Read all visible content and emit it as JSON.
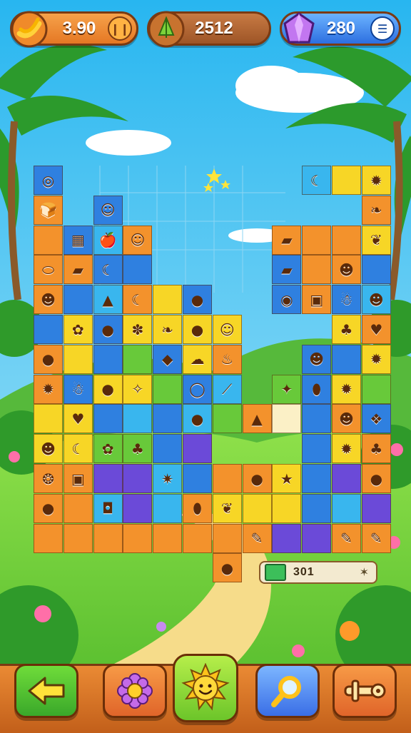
{
  "hud": {
    "coins": {
      "value": "3.90",
      "icon": "banana-bunch-icon",
      "button_icon": "pause-bars-icon"
    },
    "gems": {
      "value": "2512",
      "icon": "green-leaf-gem-icon"
    },
    "crystals": {
      "value": "280",
      "icon": "purple-crystal-icon",
      "button_icon": "menu-bars-icon"
    }
  },
  "progress_panel": {
    "value": "301",
    "icon": "green-gem-icon",
    "end_icon": "sparkle-icon"
  },
  "toolbar": [
    {
      "name": "back-button",
      "icon": "left-arrow-icon",
      "color": "#45b82c"
    },
    {
      "name": "settings-button",
      "icon": "flower-gear-icon",
      "color": "#e86a2b"
    },
    {
      "name": "sun-hint-button",
      "icon": "smiling-sun-icon",
      "color": "#8dcf2c"
    },
    {
      "name": "search-button",
      "icon": "magnifier-icon",
      "color": "#3a6ee6"
    },
    {
      "name": "tools-button",
      "icon": "wrench-icon",
      "color": "#e86a2b"
    }
  ],
  "colors": {
    "sky": "#5ac8f2",
    "grass": "#6dcf3c",
    "orange": "#f3922c",
    "yellow": "#f7d626",
    "blue": "#2f80e0",
    "green": "#68c93a",
    "purple": "#6b4ad8",
    "cyan": "#39b6ee",
    "cream": "#fbf0c6",
    "border": "#7a3a12"
  },
  "board": {
    "tiles": [
      {
        "r": 0,
        "c": 0,
        "color": "blue",
        "icon": "blue-swirl-icon",
        "glyph": "◎"
      },
      {
        "r": 1,
        "c": 0,
        "color": "orange",
        "icon": "bread-icon",
        "glyph": "🍞"
      },
      {
        "r": 1,
        "c": 2,
        "color": "blue",
        "icon": "smiling-block-icon",
        "glyph": "☺"
      },
      {
        "r": 2,
        "c": 0,
        "color": "orange",
        "icon": "",
        "glyph": ""
      },
      {
        "r": 2,
        "c": 1,
        "color": "blue",
        "icon": "green-box-icon",
        "glyph": "▦"
      },
      {
        "r": 2,
        "c": 2,
        "color": "cyan",
        "icon": "red-apple-icon",
        "glyph": "🍎"
      },
      {
        "r": 2,
        "c": 3,
        "color": "orange",
        "icon": "yellow-smile-icon",
        "glyph": "☺"
      },
      {
        "r": 3,
        "c": 0,
        "color": "orange",
        "icon": "white-egg-icon",
        "glyph": "⬭"
      },
      {
        "r": 3,
        "c": 1,
        "color": "orange",
        "icon": "orange-log-icon",
        "glyph": "▰"
      },
      {
        "r": 3,
        "c": 2,
        "color": "blue",
        "icon": "yellow-banana-icon",
        "glyph": "☾"
      },
      {
        "r": 3,
        "c": 3,
        "color": "blue",
        "icon": "",
        "glyph": ""
      },
      {
        "r": 4,
        "c": 0,
        "color": "orange",
        "icon": "brown-creature-icon",
        "glyph": "☻"
      },
      {
        "r": 4,
        "c": 1,
        "color": "blue",
        "icon": "",
        "glyph": ""
      },
      {
        "r": 4,
        "c": 2,
        "color": "cyan",
        "icon": "orange-carrot-icon",
        "glyph": "▲"
      },
      {
        "r": 4,
        "c": 3,
        "color": "orange",
        "icon": "yellow-banana-icon",
        "glyph": "☾"
      },
      {
        "r": 4,
        "c": 4,
        "color": "yellow",
        "icon": "",
        "glyph": ""
      },
      {
        "r": 4,
        "c": 5,
        "color": "blue",
        "icon": "purple-blob-icon",
        "glyph": "●"
      },
      {
        "r": 5,
        "c": 0,
        "color": "blue",
        "icon": "",
        "glyph": ""
      },
      {
        "r": 5,
        "c": 1,
        "color": "yellow",
        "icon": "green-frog-icon",
        "glyph": "✿"
      },
      {
        "r": 5,
        "c": 2,
        "color": "blue",
        "icon": "green-apple-icon",
        "glyph": "●"
      },
      {
        "r": 5,
        "c": 3,
        "color": "yellow",
        "icon": "green-bush-icon",
        "glyph": "✽"
      },
      {
        "r": 5,
        "c": 4,
        "color": "yellow",
        "icon": "purple-leaf-icon",
        "glyph": "❧"
      },
      {
        "r": 5,
        "c": 5,
        "color": "yellow",
        "icon": "orange-ball-icon",
        "glyph": "●"
      },
      {
        "r": 5,
        "c": 6,
        "color": "yellow",
        "icon": "yellow-face-icon",
        "glyph": "☺"
      },
      {
        "r": 6,
        "c": 0,
        "color": "orange",
        "icon": "orange-fruit-icon",
        "glyph": "●"
      },
      {
        "r": 6,
        "c": 1,
        "color": "yellow",
        "icon": "",
        "glyph": ""
      },
      {
        "r": 6,
        "c": 2,
        "color": "blue",
        "icon": "",
        "glyph": ""
      },
      {
        "r": 6,
        "c": 3,
        "color": "green",
        "icon": "",
        "glyph": ""
      },
      {
        "r": 6,
        "c": 4,
        "color": "blue",
        "icon": "purple-rock-icon",
        "glyph": "◆"
      },
      {
        "r": 6,
        "c": 5,
        "color": "yellow",
        "icon": "white-sheep-icon",
        "glyph": "☁"
      },
      {
        "r": 6,
        "c": 6,
        "color": "orange",
        "icon": "orange-sack-icon",
        "glyph": "♨"
      },
      {
        "r": 7,
        "c": 0,
        "color": "orange",
        "icon": "yellow-flower-icon",
        "glyph": "✹"
      },
      {
        "r": 7,
        "c": 1,
        "color": "blue",
        "icon": "white-ghost-icon",
        "glyph": "☃"
      },
      {
        "r": 7,
        "c": 2,
        "color": "yellow",
        "icon": "dark-plum-icon",
        "glyph": "●"
      },
      {
        "r": 7,
        "c": 3,
        "color": "yellow",
        "icon": "white-bird-icon",
        "glyph": "✧"
      },
      {
        "r": 7,
        "c": 4,
        "color": "green",
        "icon": "",
        "glyph": ""
      },
      {
        "r": 7,
        "c": 5,
        "color": "blue",
        "icon": "orange-ring-icon",
        "glyph": "◯"
      },
      {
        "r": 7,
        "c": 6,
        "color": "cyan",
        "icon": "white-feather-icon",
        "glyph": "⟋"
      },
      {
        "r": 8,
        "c": 0,
        "color": "yellow",
        "icon": "",
        "glyph": ""
      },
      {
        "r": 8,
        "c": 1,
        "color": "yellow",
        "icon": "red-chili-icon",
        "glyph": "♥"
      },
      {
        "r": 8,
        "c": 2,
        "color": "blue",
        "icon": "",
        "glyph": ""
      },
      {
        "r": 8,
        "c": 3,
        "color": "cyan",
        "icon": "",
        "glyph": ""
      },
      {
        "r": 8,
        "c": 4,
        "color": "blue",
        "icon": "",
        "glyph": ""
      },
      {
        "r": 8,
        "c": 5,
        "color": "cyan",
        "icon": "orange-seed-icon",
        "glyph": "●"
      },
      {
        "r": 8,
        "c": 6,
        "color": "green",
        "icon": "",
        "glyph": ""
      },
      {
        "r": 9,
        "c": 0,
        "color": "yellow",
        "icon": "grey-squirrel-icon",
        "glyph": "☻"
      },
      {
        "r": 9,
        "c": 1,
        "color": "yellow",
        "icon": "yellow-pear-icon",
        "glyph": "☾"
      },
      {
        "r": 9,
        "c": 2,
        "color": "green",
        "icon": "green-turtle-icon",
        "glyph": "✿"
      },
      {
        "r": 9,
        "c": 3,
        "color": "green",
        "icon": "green-pot-icon",
        "glyph": "♣"
      },
      {
        "r": 9,
        "c": 4,
        "color": "blue",
        "icon": "",
        "glyph": ""
      },
      {
        "r": 9,
        "c": 5,
        "color": "purple",
        "icon": "",
        "glyph": ""
      },
      {
        "r": 10,
        "c": 0,
        "color": "orange",
        "icon": "red-donut-icon",
        "glyph": "❂"
      },
      {
        "r": 10,
        "c": 1,
        "color": "orange",
        "icon": "orange-box-icon",
        "glyph": "▣"
      },
      {
        "r": 10,
        "c": 2,
        "color": "purple",
        "icon": "",
        "glyph": ""
      },
      {
        "r": 10,
        "c": 3,
        "color": "purple",
        "icon": "",
        "glyph": ""
      },
      {
        "r": 10,
        "c": 4,
        "color": "cyan",
        "icon": "orange-star-blob-icon",
        "glyph": "✷"
      },
      {
        "r": 10,
        "c": 5,
        "color": "blue",
        "icon": "",
        "glyph": ""
      },
      {
        "r": 10,
        "c": 6,
        "color": "orange",
        "icon": "",
        "glyph": ""
      },
      {
        "r": 11,
        "c": 0,
        "color": "orange",
        "icon": "orange-pumpkin-icon",
        "glyph": "●"
      },
      {
        "r": 11,
        "c": 1,
        "color": "orange",
        "icon": "",
        "glyph": ""
      },
      {
        "r": 11,
        "c": 2,
        "color": "cyan",
        "icon": "blue-robot-icon",
        "glyph": "◘"
      },
      {
        "r": 11,
        "c": 3,
        "color": "purple",
        "icon": "",
        "glyph": ""
      },
      {
        "r": 11,
        "c": 4,
        "color": "cyan",
        "icon": "",
        "glyph": ""
      },
      {
        "r": 11,
        "c": 5,
        "color": "orange",
        "icon": "orange-bean-icon",
        "glyph": "⬮"
      },
      {
        "r": 11,
        "c": 6,
        "color": "yellow",
        "icon": "green-leaf-icon",
        "glyph": "❦"
      },
      {
        "r": 12,
        "c": 0,
        "color": "orange",
        "icon": "",
        "glyph": ""
      },
      {
        "r": 12,
        "c": 1,
        "color": "orange",
        "icon": "",
        "glyph": ""
      },
      {
        "r": 12,
        "c": 2,
        "color": "orange",
        "icon": "",
        "glyph": ""
      },
      {
        "r": 12,
        "c": 3,
        "color": "orange",
        "icon": "",
        "glyph": ""
      },
      {
        "r": 12,
        "c": 4,
        "color": "orange",
        "icon": "",
        "glyph": ""
      },
      {
        "r": 12,
        "c": 5,
        "color": "orange",
        "icon": "",
        "glyph": ""
      },
      {
        "r": 12,
        "c": 6,
        "color": "orange",
        "icon": "",
        "glyph": ""
      },
      {
        "r": 12,
        "c": 7,
        "color": "orange",
        "icon": "orange-pencil-icon",
        "glyph": "✎"
      },
      {
        "r": 13,
        "c": 6,
        "color": "orange",
        "icon": "green-bug-icon",
        "glyph": "●"
      },
      {
        "r": 0,
        "c": 9,
        "color": "cyan",
        "icon": "banana-bunch-icon",
        "glyph": "☾"
      },
      {
        "r": 0,
        "c": 10,
        "color": "yellow",
        "icon": "",
        "glyph": ""
      },
      {
        "r": 0,
        "c": 11,
        "color": "yellow",
        "icon": "orange-sun-blob-icon",
        "glyph": "✹"
      },
      {
        "r": 1,
        "c": 11,
        "color": "orange",
        "icon": "orange-leaf-icon",
        "glyph": "❧"
      },
      {
        "r": 2,
        "c": 8,
        "color": "orange",
        "icon": "wood-plank-icon",
        "glyph": "▰"
      },
      {
        "r": 2,
        "c": 9,
        "color": "orange",
        "icon": "",
        "glyph": ""
      },
      {
        "r": 2,
        "c": 10,
        "color": "orange",
        "icon": "",
        "glyph": ""
      },
      {
        "r": 2,
        "c": 11,
        "color": "yellow",
        "icon": "green-leaf-icon",
        "glyph": "❦"
      },
      {
        "r": 3,
        "c": 8,
        "color": "blue",
        "icon": "wood-log-icon",
        "glyph": "▰"
      },
      {
        "r": 3,
        "c": 9,
        "color": "orange",
        "icon": "",
        "glyph": ""
      },
      {
        "r": 3,
        "c": 10,
        "color": "orange",
        "icon": "brown-bear-icon",
        "glyph": "☻"
      },
      {
        "r": 3,
        "c": 11,
        "color": "blue",
        "icon": "",
        "glyph": ""
      },
      {
        "r": 4,
        "c": 8,
        "color": "blue",
        "icon": "blue-drop-icon",
        "glyph": "◉"
      },
      {
        "r": 4,
        "c": 9,
        "color": "orange",
        "icon": "red-crate-icon",
        "glyph": "▣"
      },
      {
        "r": 4,
        "c": 10,
        "color": "blue",
        "icon": "purple-ghost-icon",
        "glyph": "☃"
      },
      {
        "r": 4,
        "c": 11,
        "color": "cyan",
        "icon": "yellow-chick-icon",
        "glyph": "☻"
      },
      {
        "r": 5,
        "c": 10,
        "color": "yellow",
        "icon": "purple-cherries-icon",
        "glyph": "♣"
      },
      {
        "r": 5,
        "c": 11,
        "color": "orange",
        "icon": "red-strawberry-icon",
        "glyph": "♥"
      },
      {
        "r": 6,
        "c": 9,
        "color": "blue",
        "icon": "brown-monkey-icon",
        "glyph": "☻"
      },
      {
        "r": 6,
        "c": 10,
        "color": "blue",
        "icon": "",
        "glyph": ""
      },
      {
        "r": 6,
        "c": 11,
        "color": "yellow",
        "icon": "yellow-star-blob-icon",
        "glyph": "✹"
      },
      {
        "r": 7,
        "c": 8,
        "color": "green",
        "icon": "green-parrot-icon",
        "glyph": "✦"
      },
      {
        "r": 7,
        "c": 9,
        "color": "blue",
        "icon": "purple-eggplant-icon",
        "glyph": "⬮"
      },
      {
        "r": 7,
        "c": 10,
        "color": "yellow",
        "icon": "yellow-flower-icon",
        "glyph": "✹"
      },
      {
        "r": 7,
        "c": 11,
        "color": "green",
        "icon": "",
        "glyph": ""
      },
      {
        "r": 8,
        "c": 7,
        "color": "orange",
        "icon": "orange-carrot-icon",
        "glyph": "▲"
      },
      {
        "r": 8,
        "c": 8,
        "color": "cream",
        "icon": "",
        "glyph": ""
      },
      {
        "r": 8,
        "c": 9,
        "color": "blue",
        "icon": "",
        "glyph": ""
      },
      {
        "r": 8,
        "c": 10,
        "color": "orange",
        "icon": "brown-bear-icon",
        "glyph": "☻"
      },
      {
        "r": 8,
        "c": 11,
        "color": "blue",
        "icon": "blue-fish-icon",
        "glyph": "❖"
      },
      {
        "r": 9,
        "c": 9,
        "color": "blue",
        "icon": "",
        "glyph": ""
      },
      {
        "r": 9,
        "c": 10,
        "color": "yellow",
        "icon": "yellow-lion-icon",
        "glyph": "✹"
      },
      {
        "r": 9,
        "c": 11,
        "color": "orange",
        "icon": "brown-sack-icon",
        "glyph": "♣"
      },
      {
        "r": 10,
        "c": 7,
        "color": "orange",
        "icon": "purple-blob-icon",
        "glyph": "●"
      },
      {
        "r": 10,
        "c": 8,
        "color": "yellow",
        "icon": "yellow-star-icon",
        "glyph": "★"
      },
      {
        "r": 10,
        "c": 9,
        "color": "blue",
        "icon": "",
        "glyph": ""
      },
      {
        "r": 10,
        "c": 10,
        "color": "purple",
        "icon": "",
        "glyph": ""
      },
      {
        "r": 10,
        "c": 11,
        "color": "orange",
        "icon": "brown-blob-icon",
        "glyph": "●"
      },
      {
        "r": 11,
        "c": 7,
        "color": "yellow",
        "icon": "",
        "glyph": ""
      },
      {
        "r": 11,
        "c": 8,
        "color": "yellow",
        "icon": "",
        "glyph": ""
      },
      {
        "r": 11,
        "c": 9,
        "color": "blue",
        "icon": "",
        "glyph": ""
      },
      {
        "r": 11,
        "c": 10,
        "color": "cyan",
        "icon": "",
        "glyph": ""
      },
      {
        "r": 11,
        "c": 11,
        "color": "purple",
        "icon": "",
        "glyph": ""
      },
      {
        "r": 12,
        "c": 8,
        "color": "purple",
        "icon": "",
        "glyph": ""
      },
      {
        "r": 12,
        "c": 9,
        "color": "purple",
        "icon": "",
        "glyph": ""
      },
      {
        "r": 12,
        "c": 10,
        "color": "orange",
        "icon": "orange-pencil-icon",
        "glyph": "✎"
      },
      {
        "r": 12,
        "c": 11,
        "color": "orange",
        "icon": "brown-twig-icon",
        "glyph": "✎"
      }
    ]
  }
}
